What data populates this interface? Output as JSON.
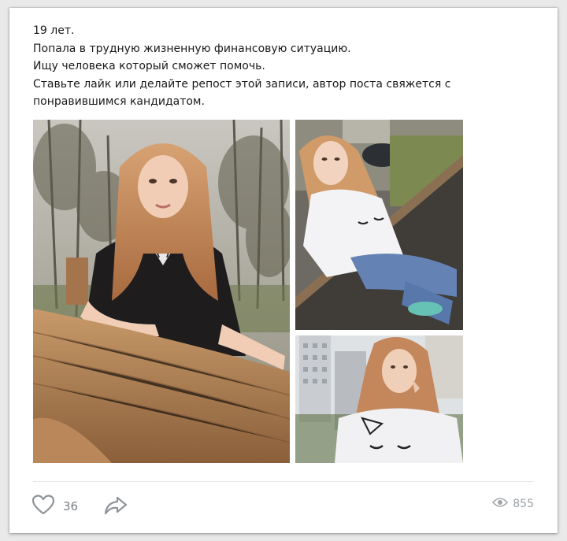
{
  "post": {
    "text_lines": [
      "19 лет.",
      "Попала в трудную жизненную финансовую ситуацию.",
      "Ищу человека который сможет помочь.",
      "Ставьте лайк или делайте репост этой записи, автор поста свяжется с",
      "понравившимся кандидатом."
    ],
    "photos": [
      {
        "name": "photo-main",
        "description_icon": "photo"
      },
      {
        "name": "photo-top-right",
        "description_icon": "photo"
      },
      {
        "name": "photo-bottom-right",
        "description_icon": "photo"
      }
    ]
  },
  "footer": {
    "like_icon": "heart-icon",
    "likes": "36",
    "share_icon": "share-arrow-icon",
    "views_icon": "eye-icon",
    "views": "855"
  },
  "colors": {
    "icon_gray": "#8e9499",
    "text": "#1a1a1a",
    "count": "#7a7f86"
  }
}
